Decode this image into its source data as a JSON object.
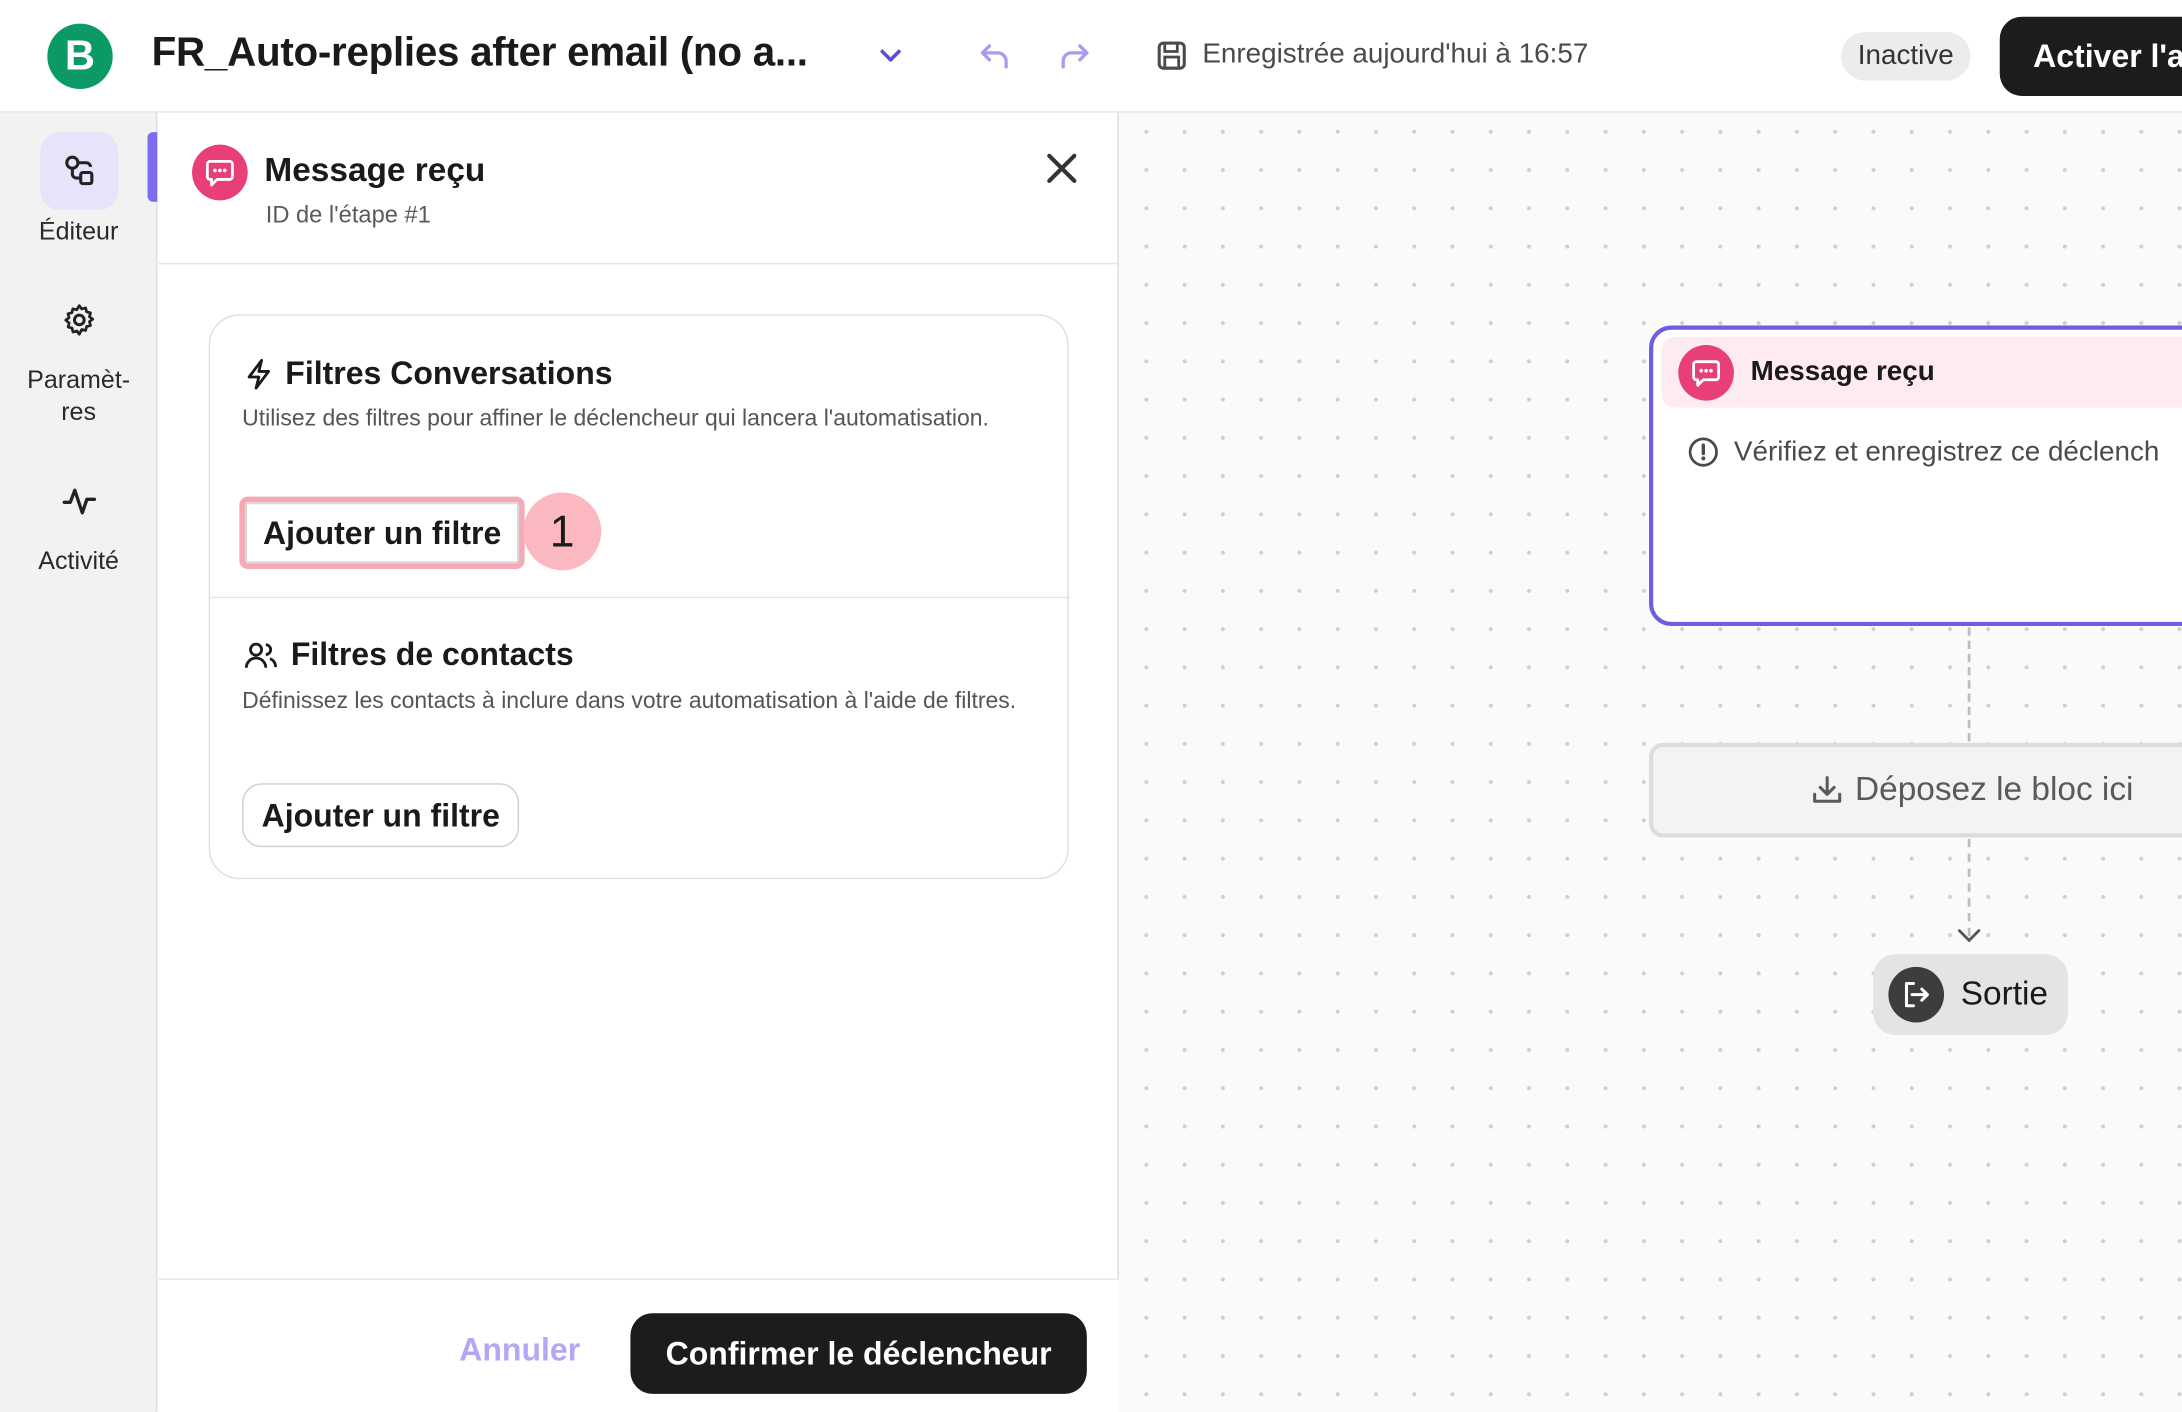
{
  "app": {
    "logo_letter": "B",
    "title": "FR_Auto-replies after email (no a...",
    "saved_text": "Enregistrée aujourd'hui à 16:57",
    "status": "Inactive",
    "activate_label": "Activer l'a"
  },
  "rail": {
    "items": [
      {
        "label": "Éditeur",
        "icon": "editor-icon",
        "active": true
      },
      {
        "label": "Paramèt-\nres",
        "icon": "gear-icon",
        "active": false
      },
      {
        "label": "Activité",
        "icon": "activity-icon",
        "active": false
      }
    ]
  },
  "panel": {
    "title": "Message reçu",
    "subtitle": "ID de l'étape #1",
    "conversation_filters": {
      "title": "Filtres Conversations",
      "description": "Utilisez des filtres pour affiner le déclencheur qui lancera l'automatisation.",
      "button": "Ajouter un filtre"
    },
    "contact_filters": {
      "title": "Filtres de contacts",
      "description": "Définissez les contacts à inclure dans votre automatisation à l'aide de filtres.",
      "button": "Ajouter un filtre"
    },
    "step_badge": "1",
    "cancel_label": "Annuler",
    "confirm_label": "Confirmer le déclencheur"
  },
  "canvas": {
    "trigger_node": {
      "title": "Message reçu",
      "warning": "Vérifiez et enregistrez ce déclench"
    },
    "drop_zone": "Déposez le bloc ici",
    "exit_label": "Sortie"
  },
  "colors": {
    "brand": "#0b9a66",
    "accent": "#6b5fe0",
    "trigger": "#e83f7a",
    "highlight": "#f4a9b5",
    "dark_button": "#1c1c1c"
  }
}
